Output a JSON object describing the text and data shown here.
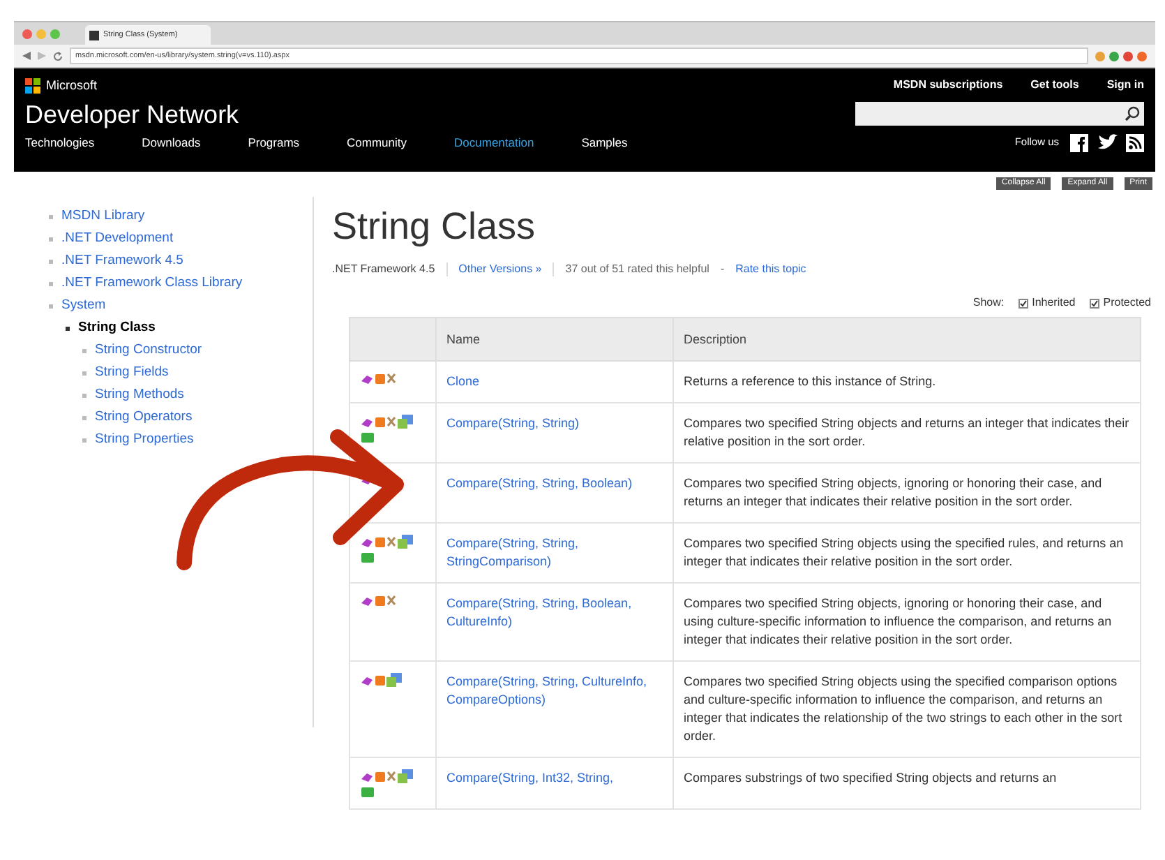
{
  "browser": {
    "tab_title": "String Class (System)",
    "url": "msdn.microsoft.com/en-us/library/system.string(v=vs.110).aspx"
  },
  "header": {
    "brand": "Microsoft",
    "site": "Developer Network",
    "top_links": [
      "MSDN subscriptions",
      "Get tools",
      "Sign in"
    ],
    "nav": [
      {
        "label": "Technologies",
        "selected": false
      },
      {
        "label": "Downloads",
        "selected": false
      },
      {
        "label": "Programs",
        "selected": false
      },
      {
        "label": "Community",
        "selected": false
      },
      {
        "label": "Documentation",
        "selected": true
      },
      {
        "label": "Samples",
        "selected": false
      }
    ],
    "follow": "Follow us"
  },
  "toolbar_buttons": [
    "Collapse All",
    "Expand All",
    "Print"
  ],
  "sidebar": {
    "items": [
      {
        "label": "MSDN Library",
        "selected": false
      },
      {
        "label": ".NET Development",
        "selected": false
      },
      {
        "label": ".NET Framework 4.5",
        "selected": false
      },
      {
        "label": ".NET Framework Class Library",
        "selected": false
      },
      {
        "label": "System",
        "selected": false,
        "children": [
          {
            "label": "String Class",
            "selected": true,
            "children": [
              {
                "label": "String Constructor",
                "selected": false
              },
              {
                "label": "String Fields",
                "selected": false
              },
              {
                "label": "String Methods",
                "selected": false
              },
              {
                "label": "String Operators",
                "selected": false
              },
              {
                "label": "String Properties",
                "selected": false
              }
            ]
          }
        ]
      }
    ]
  },
  "page": {
    "title": "String Class",
    "framework": ".NET Framework 4.5",
    "other_versions": "Other Versions »",
    "rating": "37 out of 51 rated this helpful",
    "separator": "-",
    "rate_link": "Rate this topic",
    "show_label": "Show:",
    "filters": [
      {
        "label": "Inherited",
        "checked": true
      },
      {
        "label": "Protected",
        "checked": true
      }
    ]
  },
  "table": {
    "columns": [
      "",
      "Name",
      "Description"
    ],
    "rows": [
      {
        "kind": "basic",
        "name": "Clone",
        "description": "Returns a reference to this instance of String."
      },
      {
        "kind": "store",
        "name": "Compare(String, String)",
        "description": "Compares two specified String objects and returns an integer that indicates their relative position in the sort order."
      },
      {
        "kind": "single",
        "name": "Compare(String, String, Boolean)",
        "description": "Compares two specified String objects, ignoring or honoring their case, and returns an integer that indicates their relative position in the sort order."
      },
      {
        "kind": "store",
        "name": "Compare(String, String, StringComparison)",
        "description": "Compares two specified String objects using the specified rules, and returns an integer that indicates their relative position in the sort order."
      },
      {
        "kind": "basic",
        "name": "Compare(String, String, Boolean, CultureInfo)",
        "description": "Compares two specified String objects, ignoring or honoring their case, and using culture-specific information to influence the comparison, and returns an integer that indicates their relative position in the sort order."
      },
      {
        "kind": "compact",
        "name": "Compare(String, String, CultureInfo, CompareOptions)",
        "description": "Compares two specified String objects using the specified comparison options and culture-specific information to influence the comparison, and returns an integer that indicates the relationship of the two strings to each other in the sort order."
      },
      {
        "kind": "store",
        "name": "Compare(String, Int32, String,",
        "description": "Compares substrings of two specified String objects and returns an"
      }
    ]
  }
}
